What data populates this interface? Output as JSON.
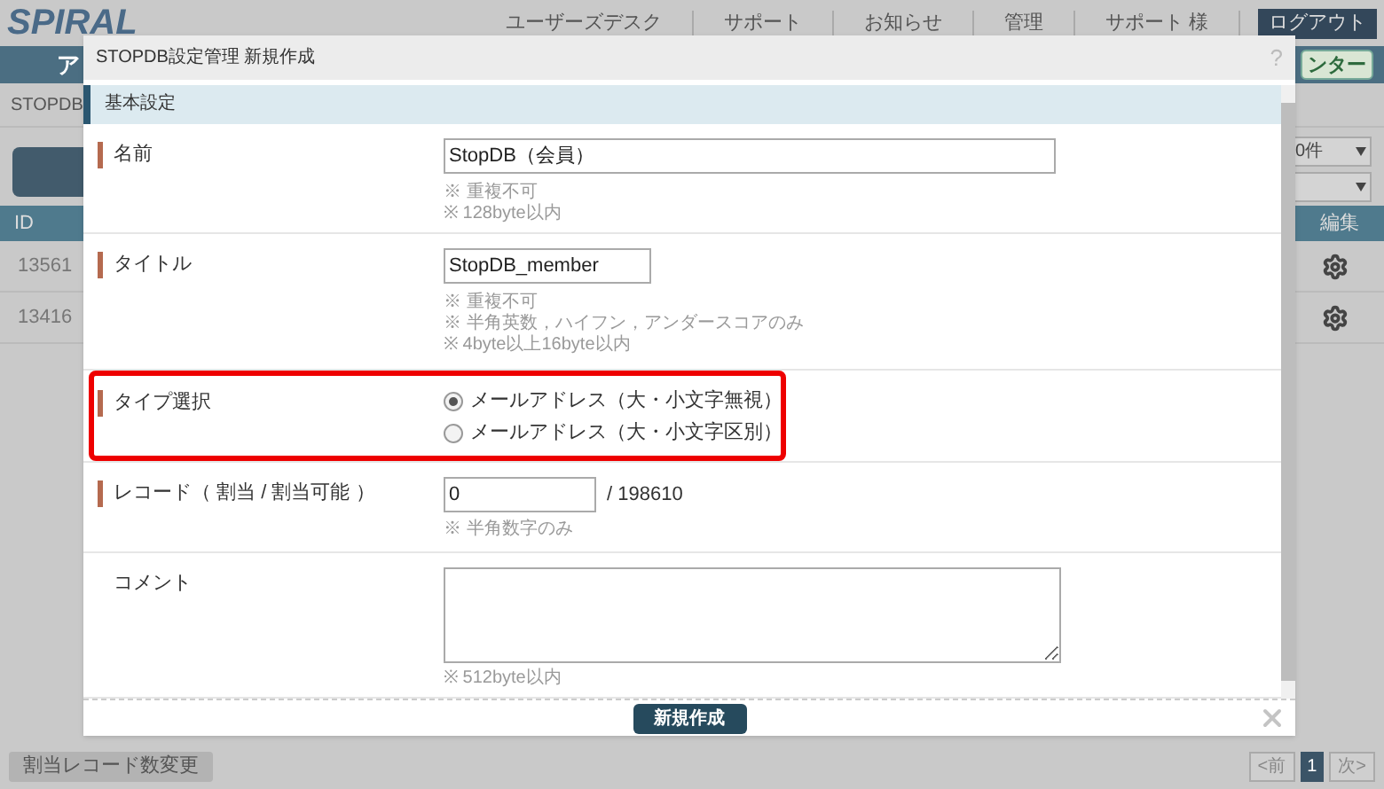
{
  "header": {
    "logo": "SPIRAL",
    "nav": [
      "ユーザーズデスク",
      "サポート",
      "お知らせ",
      "管理",
      "サポート 様"
    ],
    "logout": "ログアウト"
  },
  "app_bar": {
    "title": "ア",
    "button": "ンター"
  },
  "breadcrumb": "STOPDB",
  "per_page": {
    "value": "0件"
  },
  "table": {
    "columns": [
      "ID",
      "編集"
    ],
    "rows": [
      {
        "id": "13561"
      },
      {
        "id": "13416"
      }
    ]
  },
  "footer": {
    "button": "割当レコード数変更",
    "pages": [
      {
        "label": "<前",
        "selected": false
      },
      {
        "label": "1",
        "selected": true
      },
      {
        "label": "次>",
        "selected": false
      }
    ]
  },
  "dialog": {
    "title": "STOPDB設定管理 新規作成",
    "help": "?",
    "section": "基本設定",
    "fields": [
      {
        "kind": "text",
        "label": "名前",
        "required": true,
        "highlighted": false,
        "value": "StopDB（会員）",
        "notes": [
          "※ 重複不可",
          "※ 128byte以内"
        ]
      },
      {
        "kind": "text_short",
        "label": "タイトル",
        "required": true,
        "highlighted": false,
        "value": "StopDB_member",
        "notes": [
          "※ 重複不可",
          "※ 半角英数，ハイフン，アンダースコアのみ",
          "※ 4byte以上16byte以内"
        ]
      },
      {
        "kind": "radio",
        "label": "タイプ選択",
        "required": true,
        "highlighted": true,
        "options": [
          {
            "label": "メールアドレス（大・小文字無視）",
            "selected": true
          },
          {
            "label": "メールアドレス（大・小文字区別）",
            "selected": false
          }
        ]
      },
      {
        "kind": "number",
        "label": "レコード（ 割当 / 割当可能 ）",
        "required": true,
        "highlighted": false,
        "value": "0",
        "suffix": "/ 198610",
        "notes": [
          "※ 半角数字のみ"
        ]
      },
      {
        "kind": "textarea",
        "label": "コメント",
        "required": false,
        "highlighted": false,
        "notes": [
          "※ 512byte以内"
        ]
      }
    ],
    "submit": "新規作成"
  }
}
